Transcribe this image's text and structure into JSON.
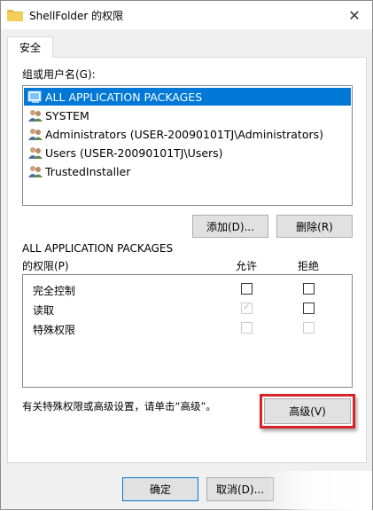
{
  "window": {
    "title": "ShellFolder 的权限",
    "close_glyph": "✕"
  },
  "tabs": [
    {
      "label": "安全",
      "active": true
    }
  ],
  "users": {
    "label": "组或用户名(G):",
    "items": [
      {
        "name": "ALL APPLICATION PACKAGES",
        "icon": "app-packages-icon",
        "selected": true
      },
      {
        "name": "SYSTEM",
        "icon": "users-group-icon",
        "selected": false
      },
      {
        "name": "Administrators (USER-20090101TJ\\Administrators)",
        "icon": "users-group-icon",
        "selected": false
      },
      {
        "name": "Users (USER-20090101TJ\\Users)",
        "icon": "users-group-icon",
        "selected": false
      },
      {
        "name": "TrustedInstaller",
        "icon": "users-group-icon",
        "selected": false
      }
    ],
    "add_label": "添加(D)...",
    "remove_label": "删除(R)"
  },
  "permissions": {
    "subject": "ALL APPLICATION PACKAGES",
    "label": "的权限(P)",
    "allow_header": "允许",
    "deny_header": "拒绝",
    "rows": [
      {
        "name": "完全控制",
        "allow": false,
        "deny": false,
        "enabled": true
      },
      {
        "name": "读取",
        "allow": true,
        "deny": false,
        "enabled": "allow-disabled"
      },
      {
        "name": "特殊权限",
        "allow": false,
        "deny": false,
        "enabled": false
      }
    ]
  },
  "advanced": {
    "hint": "有关特殊权限或高级设置，请单击“高级”。",
    "button_label": "高级(V)"
  },
  "footer": {
    "ok_label": "确定",
    "cancel_label": "取消(D)..."
  },
  "colors": {
    "selection": "#0078d7",
    "highlight_border": "#d9232b"
  }
}
